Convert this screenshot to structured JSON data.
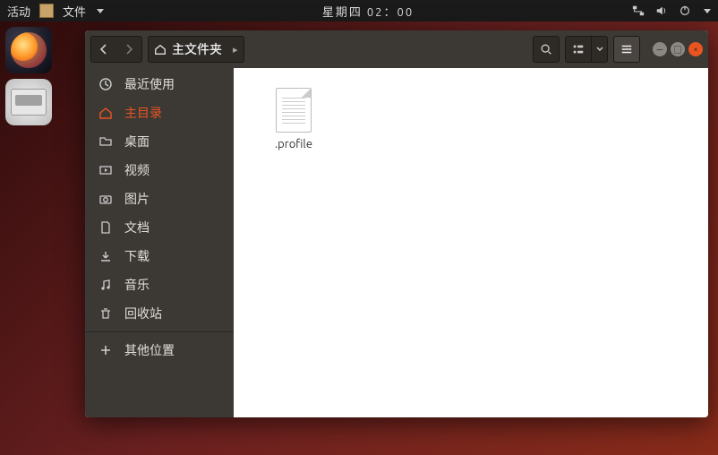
{
  "topbar": {
    "activities": "活动",
    "app_label": "文件",
    "clock": "星期四 02：00"
  },
  "window": {
    "breadcrumb": "主文件夹"
  },
  "sidebar": {
    "recent": "最近使用",
    "home": "主目录",
    "desktop": "桌面",
    "videos": "视频",
    "pictures": "图片",
    "documents": "文档",
    "downloads": "下载",
    "music": "音乐",
    "trash": "回收站",
    "other": "其他位置"
  },
  "files": {
    "item0": {
      "name": ".profile"
    }
  }
}
